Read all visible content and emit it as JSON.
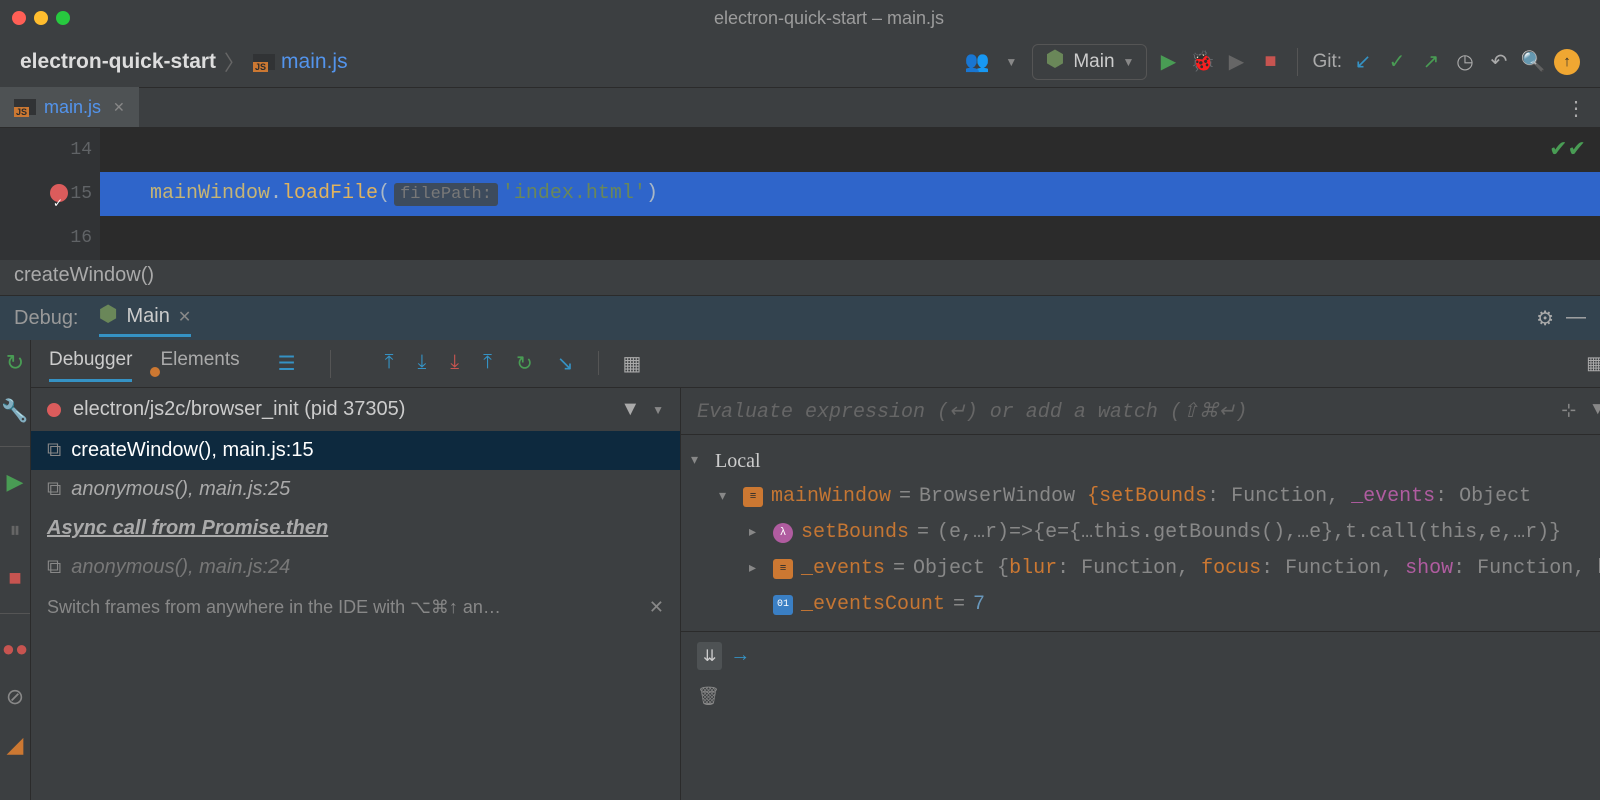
{
  "window": {
    "title": "electron-quick-start – main.js"
  },
  "breadcrumb": {
    "project": "electron-quick-start",
    "file": "main.js"
  },
  "runConfig": {
    "name": "Main"
  },
  "gitLabel": "Git:",
  "editorTab": {
    "file": "main.js"
  },
  "editor": {
    "lines": [
      "14",
      "15",
      "16"
    ],
    "code": {
      "obj": "mainWindow",
      "method": "loadFile",
      "hint": "filePath:",
      "str": "'index.html'"
    },
    "context": "createWindow()"
  },
  "debug": {
    "title": "Debug:",
    "config": "Main",
    "tabs": {
      "debugger": "Debugger",
      "elements": "Elements"
    },
    "thread": "electron/js2c/browser_init (pid 37305)",
    "frames": [
      {
        "fn": "createWindow",
        "loc": "main.js:15",
        "italic": false
      },
      {
        "fn": "anonymous",
        "loc": "main.js:25",
        "italic": true
      }
    ],
    "asyncLabel": "Async call from Promise.then",
    "frames2": [
      {
        "fn": "anonymous",
        "loc": "main.js:24",
        "italic": true
      }
    ],
    "tip": "Switch frames from anywhere in the IDE with ⌥⌘↑ an…",
    "eval": {
      "placeholder": "Evaluate expression (↵) or add a watch (⇧⌘↵)"
    },
    "vars": {
      "scope": "Local",
      "mainWindow": {
        "name": "mainWindow",
        "type": "BrowserWindow",
        "preview": "{setBounds: Function, _events: Object",
        "children": {
          "setBounds": {
            "name": "setBounds",
            "val": "(e,…r)=>{e={…this.getBounds(),…e},t.call(this,e,…r)}"
          },
          "events": {
            "name": "_events",
            "type": "Object",
            "preview": "{blur: Function, focus: Function, show: Function, h"
          },
          "eventsCount": {
            "name": "_eventsCount",
            "val": "7"
          }
        }
      }
    }
  }
}
